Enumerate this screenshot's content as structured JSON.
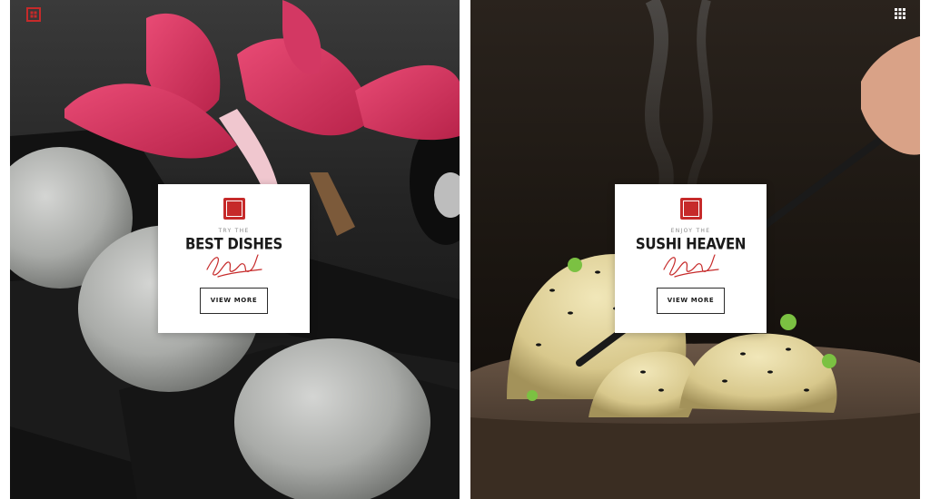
{
  "panels": [
    {
      "kicker": "TRY THE",
      "title": "BEST DISHES",
      "button_label": "VIEW MORE",
      "image_subject": "mochi-with-pink-flower",
      "menu_icon": "grid-square-icon"
    },
    {
      "kicker": "ENJOY THE",
      "title": "SUSHI HEAVEN",
      "button_label": "VIEW MORE",
      "image_subject": "steaming-dumplings-with-chopsticks",
      "menu_icon": "dots-grid-icon"
    }
  ],
  "colors": {
    "seal_red": "#c62a2a",
    "signature_red": "#c62a2a",
    "card_bg": "#ffffff",
    "flower_pink": "#e0416a"
  }
}
